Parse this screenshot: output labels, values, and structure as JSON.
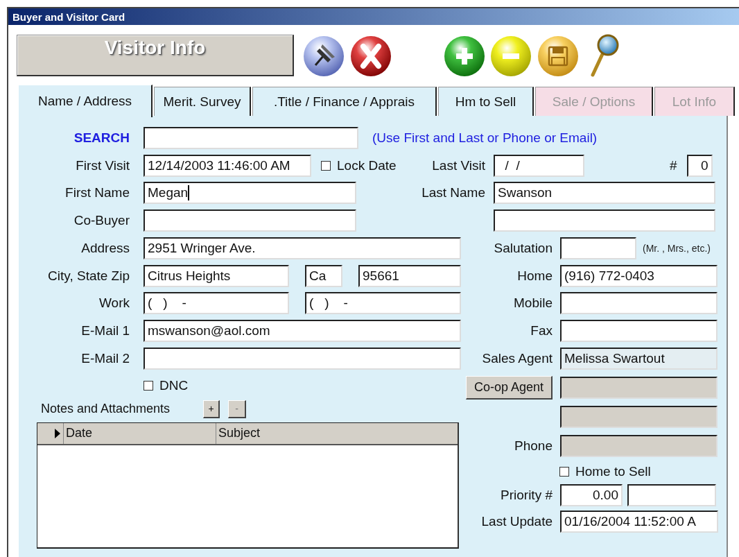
{
  "window": {
    "title": "Buyer and Visitor Card"
  },
  "header": {
    "title": "Visitor Info"
  },
  "tabs": [
    {
      "label": "Name / Address",
      "selected": true,
      "disabled": false
    },
    {
      "label": "Merit. Survey",
      "selected": false,
      "disabled": false
    },
    {
      "label": ".Title / Finance / Apprais",
      "selected": false,
      "disabled": false
    },
    {
      "label": "Hm to Sell",
      "selected": false,
      "disabled": false
    },
    {
      "label": "Sale / Options",
      "selected": false,
      "disabled": true
    },
    {
      "label": "Lot Info",
      "selected": false,
      "disabled": true
    }
  ],
  "form": {
    "search": {
      "label": "SEARCH",
      "hint": "(Use First and Last or Phone or Email)"
    },
    "first_visit": {
      "label": "First Visit",
      "value": "12/14/2003 11:46:00 AM"
    },
    "lock_date": {
      "label": "Lock Date",
      "checked": false
    },
    "last_visit": {
      "label": "Last Visit",
      "value": "  /  /"
    },
    "visit_count": {
      "label": "#",
      "value": "0"
    },
    "first_name": {
      "label": "First Name",
      "value": "Megan",
      "focused": true
    },
    "last_name": {
      "label": "Last Name",
      "value": "Swanson"
    },
    "co_buyer": {
      "label": "Co-Buyer"
    },
    "address": {
      "label": "Address",
      "value": "2951 Wringer Ave."
    },
    "salutation": {
      "label": "Salutation",
      "hint": "(Mr. , Mrs., etc.)"
    },
    "city_state_zip": {
      "label": "City, State Zip",
      "city": "Citrus Heights",
      "state": "Ca",
      "zip": "95661"
    },
    "home": {
      "label": "Home",
      "value": "(916) 772-0403"
    },
    "work": {
      "label": "Work",
      "values": [
        "(   )    -",
        "(   )    -"
      ]
    },
    "mobile": {
      "label": "Mobile"
    },
    "email_1": {
      "label": "E-Mail 1",
      "value": "mswanson@aol.com"
    },
    "fax": {
      "label": "Fax"
    },
    "email_2": {
      "label": "E-Mail 2"
    },
    "sales_agent": {
      "label": "Sales Agent",
      "value": "Melissa Swartout",
      "locked": true
    },
    "dnc": {
      "label": "DNC",
      "checked": false
    },
    "coop_agent": {
      "label": "Co-op Agent",
      "disabled": true
    },
    "phone": {
      "label": "Phone",
      "disabled": true
    },
    "home_to_sell": {
      "label": "Home to Sell",
      "checked": false
    },
    "priority": {
      "label": "Priority #",
      "value": "0.00"
    },
    "last_update": {
      "label": "Last Update",
      "value": "01/16/2004 11:52:00 A"
    }
  },
  "notes": {
    "title": "Notes and Attachments",
    "add": "+",
    "remove": "-",
    "columns": [
      "Date",
      "Subject"
    ]
  }
}
